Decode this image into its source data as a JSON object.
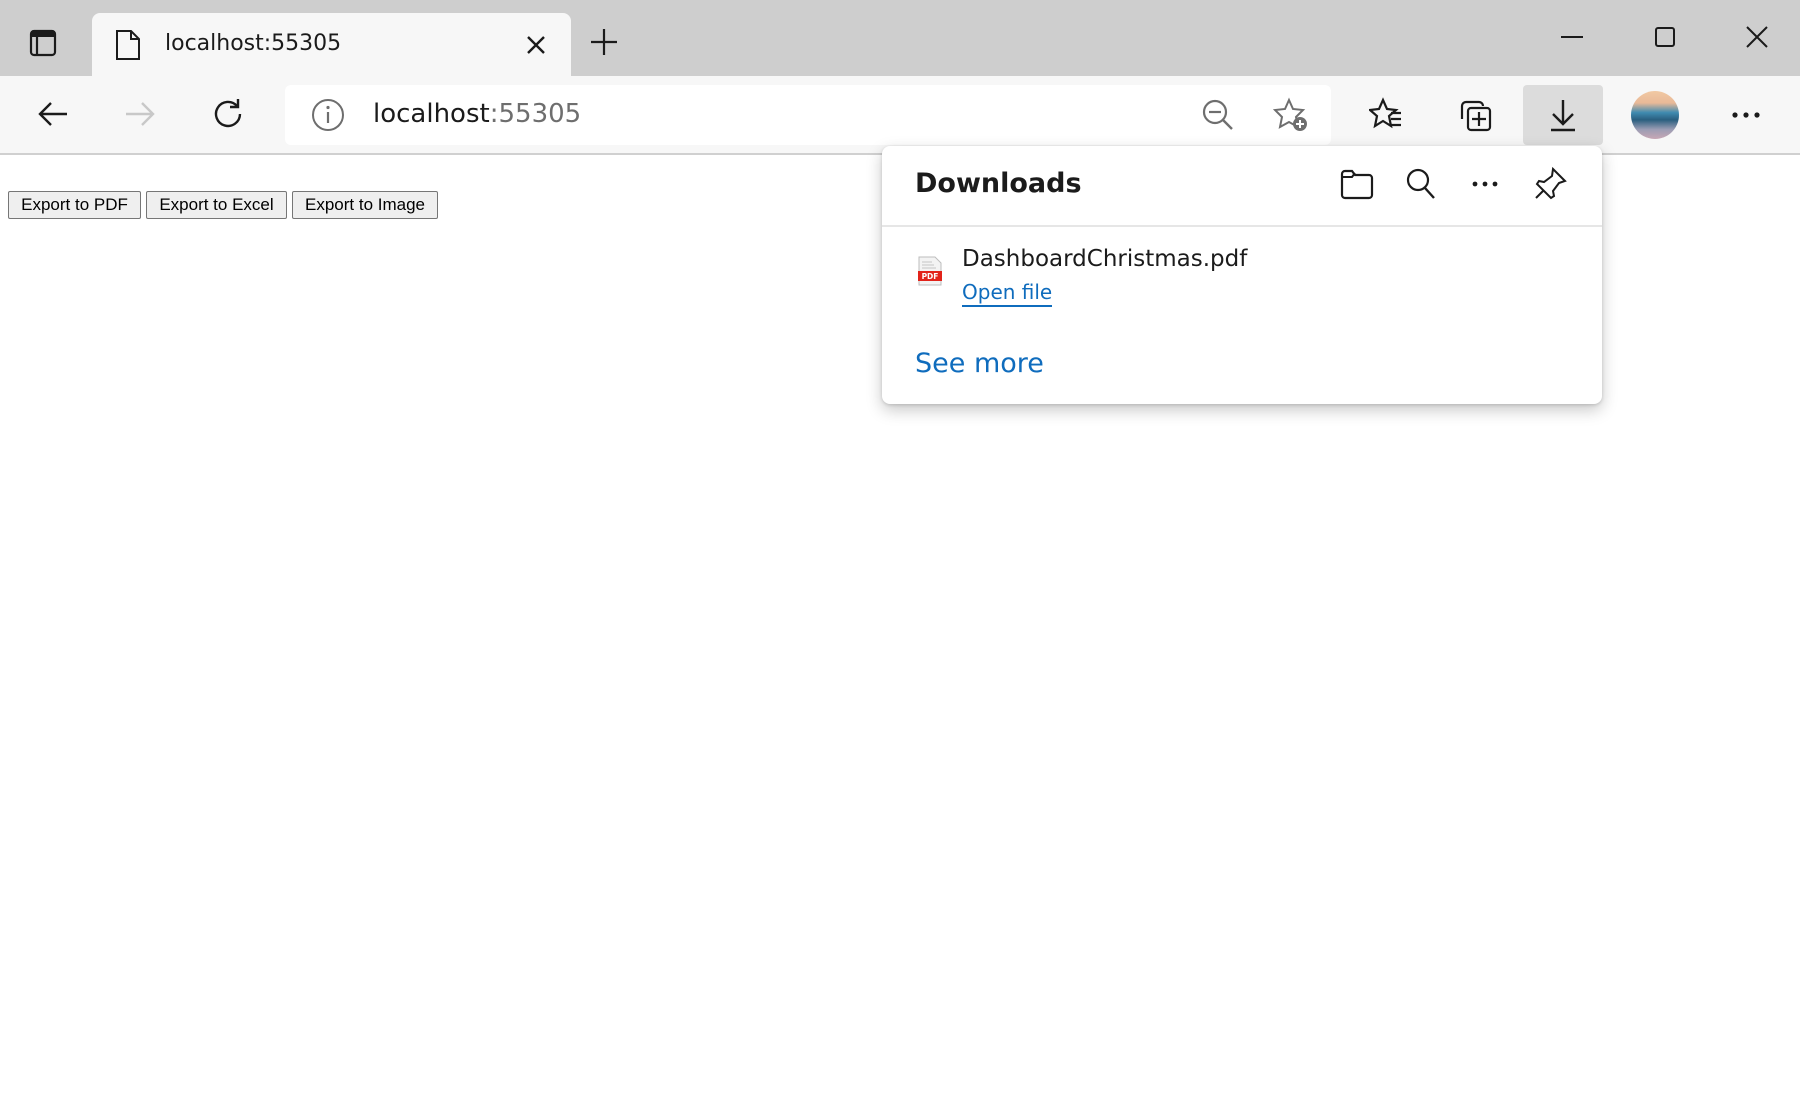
{
  "browser": {
    "tab": {
      "title": "localhost:55305"
    },
    "address": {
      "host": "localhost",
      "port": ":55305"
    },
    "icons": {
      "tab_actions": "tab-actions-icon",
      "new_tab": "plus-icon",
      "back": "arrow-left-icon",
      "forward": "arrow-right-icon",
      "refresh": "refresh-icon",
      "site_info": "info-icon",
      "zoom": "zoom-out-icon",
      "add_favorite": "star-add-icon",
      "favorites": "favorites-icon",
      "collections": "collections-icon",
      "downloads": "download-icon",
      "menu": "more-icon"
    }
  },
  "page": {
    "buttons": [
      {
        "label": "Export to PDF"
      },
      {
        "label": "Export to Excel"
      },
      {
        "label": "Export to Image"
      }
    ]
  },
  "downloads_panel": {
    "title": "Downloads",
    "items": [
      {
        "filename": "DashboardChristmas.pdf",
        "action": "Open file",
        "type": "pdf"
      }
    ],
    "see_more": "See more",
    "accent": "#0f6cbd"
  }
}
